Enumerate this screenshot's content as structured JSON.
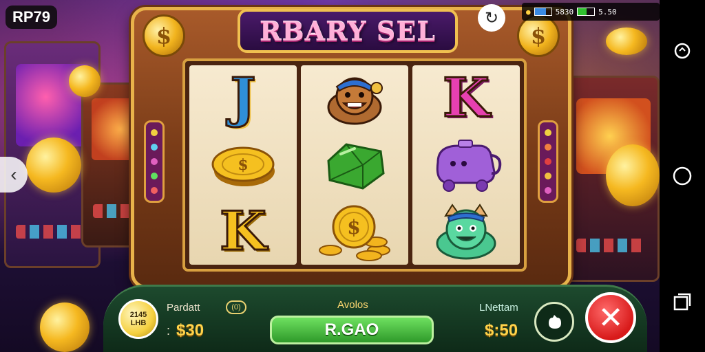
{
  "overlay": {
    "rp_label": "RP79",
    "prev_arrow": "‹"
  },
  "status": {
    "left_value": "5830",
    "right_value": "5.50"
  },
  "game": {
    "title": "RBARY SEL",
    "reels": [
      [
        "J",
        "coin-gold-icon",
        "K"
      ],
      [
        "mascot-creature-icon",
        "green-gem-icon",
        "coin-pile-icon"
      ],
      [
        "K",
        "purple-creature-icon",
        "green-creature-icon"
      ]
    ]
  },
  "panel": {
    "badge_top": "2145",
    "badge_bottom": "LHB",
    "left_label": "Pardatt",
    "left_value": "$30",
    "left_prefix": ":",
    "mini_pill": "(0)",
    "center_label": "Avolos",
    "spin_label": "R.GAO",
    "right_label": "LNettam",
    "right_value": "$:50"
  },
  "colors": {
    "accent_gold": "#f0c050",
    "spin_green": "#2f9a2a",
    "close_red": "#d81a1a"
  }
}
